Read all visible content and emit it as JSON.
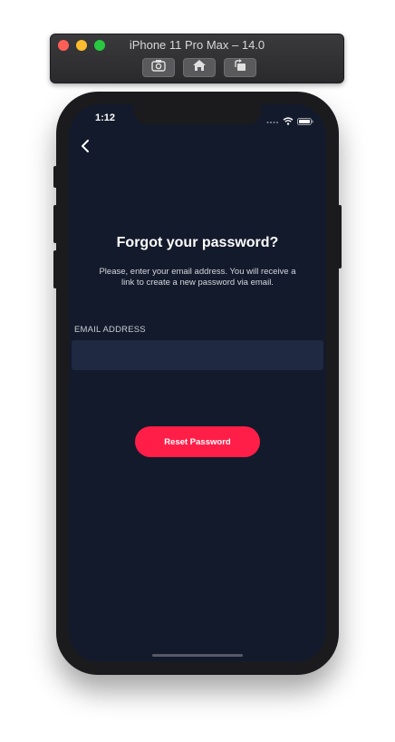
{
  "simulator": {
    "title": "iPhone 11 Pro Max – 14.0",
    "buttons": [
      {
        "icon": "screenshot-icon"
      },
      {
        "icon": "home-icon"
      },
      {
        "icon": "rotate-icon"
      }
    ]
  },
  "status_bar": {
    "time": "1:12"
  },
  "screen": {
    "title": "Forgot your password?",
    "description": "Please, enter your email address. You will receive a link to create a new password via email.",
    "email_label": "EMAIL ADDRESS",
    "email_value": "",
    "email_placeholder": "",
    "submit_label": "Reset Password"
  },
  "colors": {
    "background": "#131a2b",
    "input_background": "#1f2941",
    "accent": "#ff1e47"
  }
}
